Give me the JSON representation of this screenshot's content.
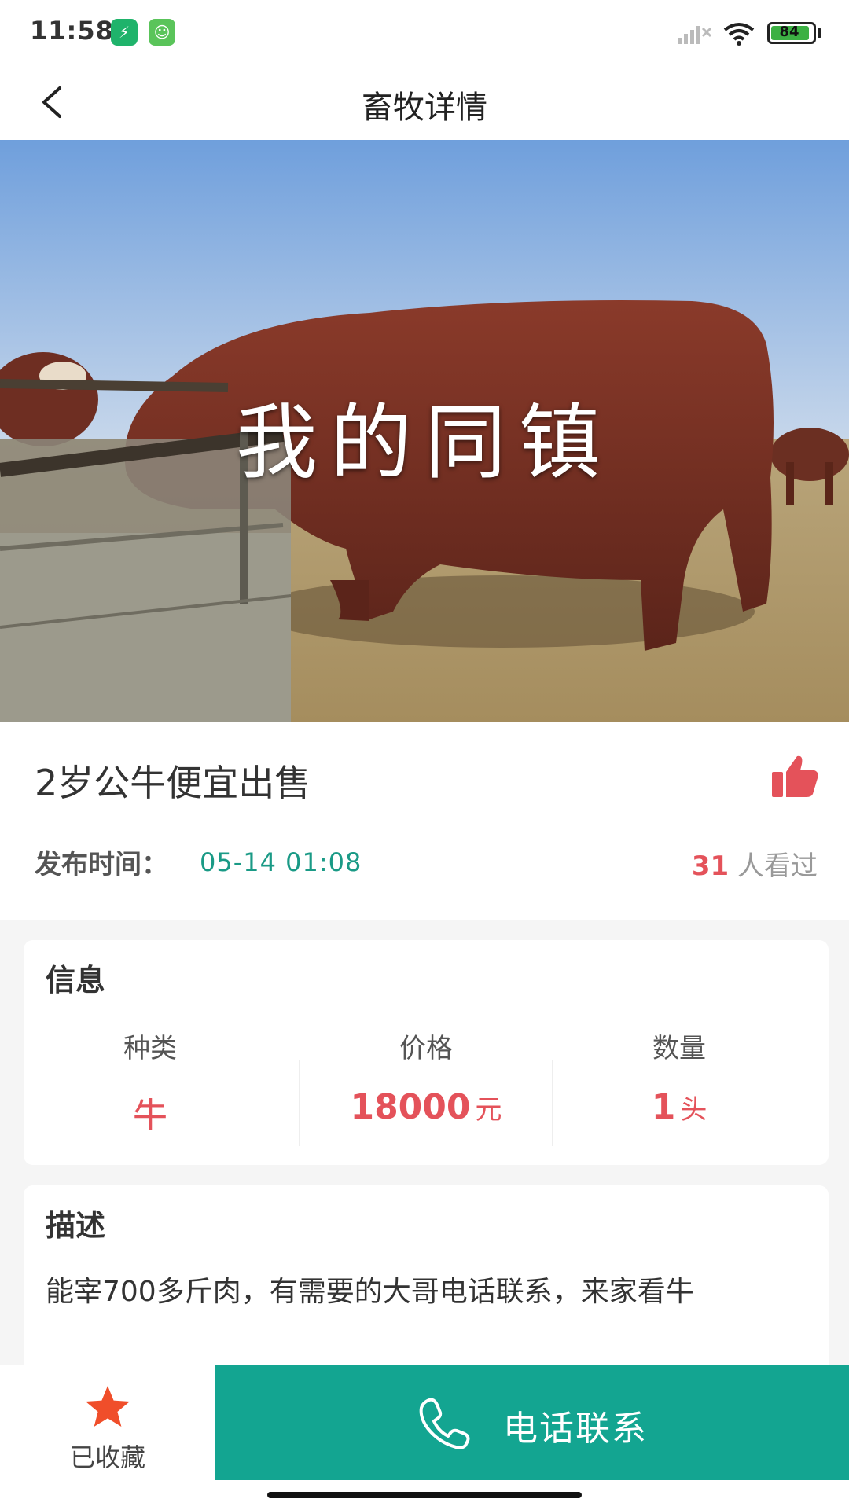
{
  "status_bar": {
    "time": "11:58",
    "battery": "84",
    "icons": [
      "app-badge-icon",
      "app-badge-icon",
      "signal-icon",
      "wifi-icon",
      "battery-icon"
    ]
  },
  "header": {
    "title": "畜牧详情",
    "back_icon": "chevron-left-icon"
  },
  "hero": {
    "watermark": "我的同镇",
    "slide_count": 1,
    "active_slide": 1
  },
  "listing": {
    "title": "2岁公牛便宜出售",
    "publish_label": "发布时间：",
    "publish_time": "05-14 01:08",
    "views_count": "31",
    "views_suffix": "人看过",
    "like_icon": "thumbs-up-icon"
  },
  "info": {
    "heading": "信息",
    "kind_label": "种类",
    "kind_value": "牛",
    "price_label": "价格",
    "price_value": "18000",
    "price_unit": "元",
    "qty_label": "数量",
    "qty_value": "1",
    "qty_unit": "头"
  },
  "description": {
    "heading": "描述",
    "text": "能宰700多斤肉，有需要的大哥电话联系，来家看牛"
  },
  "bottom_bar": {
    "favorite_label": "已收藏",
    "favorite_icon": "star-icon",
    "call_label": "电话联系",
    "call_icon": "phone-icon"
  },
  "colors": {
    "accent_green": "#13a591",
    "highlight_red": "#e4525a",
    "star_orange": "#f04e2a"
  }
}
